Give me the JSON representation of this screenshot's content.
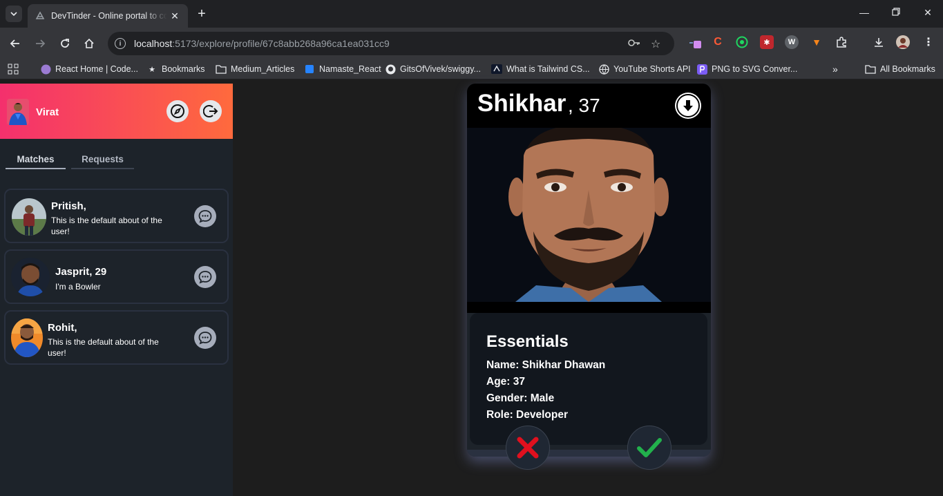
{
  "browser": {
    "tab_title": "DevTinder - Online portal to connect developers",
    "url_host": "localhost",
    "url_path": ":5173/explore/profile/67c8abb268a96ca1ea031cc9",
    "bookmarks": [
      "React Home | Code...",
      "Bookmarks",
      "Medium_Articles",
      "Namaste_React",
      "GitsOfVivek/swiggy...",
      "What is Tailwind CS...",
      "YouTube Shorts API",
      "PNG to SVG Conver..."
    ],
    "all_bookmarks": "All Bookmarks"
  },
  "sidebar": {
    "user_name": "Virat",
    "tabs": [
      "Matches",
      "Requests"
    ],
    "connections": [
      {
        "name": "Pritish,",
        "about": "This is the default about of the user!"
      },
      {
        "name": "Jasprit, 29",
        "about": "I'm a Bowler"
      },
      {
        "name": "Rohit,",
        "about": "This is the default about of the user!"
      }
    ]
  },
  "profile": {
    "first_name": "Shikhar",
    "age_suffix": ", 37",
    "essentials_title": "Essentials",
    "rows": [
      "Name: Shikhar Dhawan",
      "Age: 37",
      "Gender: Male",
      "Role: Developer"
    ]
  },
  "colors": {
    "header_gradient_start": "#f4306d",
    "header_gradient_end": "#ff6a3d",
    "reject": "#e0101e",
    "accept": "#22b14c"
  }
}
